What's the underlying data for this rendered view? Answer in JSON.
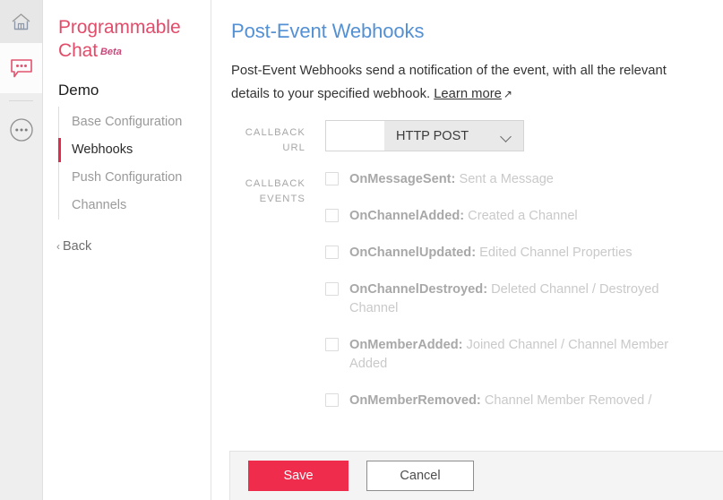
{
  "rail": {
    "items": [
      {
        "name": "home-icon",
        "label": "Home"
      },
      {
        "name": "chat-icon",
        "label": "Programmable Chat"
      },
      {
        "name": "more-icon",
        "label": "More"
      }
    ]
  },
  "sidebar": {
    "brand": "Programmable Chat",
    "brand_badge": "Beta",
    "section_title": "Demo",
    "items": [
      {
        "label": "Base Configuration",
        "active": false
      },
      {
        "label": "Webhooks",
        "active": true
      },
      {
        "label": "Push Configuration",
        "active": false
      },
      {
        "label": "Channels",
        "active": false
      }
    ],
    "back_label": "Back",
    "back_chevron": "‹"
  },
  "main": {
    "title": "Post-Event Webhooks",
    "description_line1": "Post-Event Webhooks send a notification of the event, with all the relevant",
    "description_line2_prefix": "details to your specified webhook. ",
    "learn_more_label": "Learn more",
    "learn_more_arrow": "↗",
    "callback_url": {
      "label": "Callback URL",
      "input_value": "",
      "input_placeholder": "",
      "method_selected": "HTTP POST"
    },
    "callback_events": {
      "label": "Callback Events",
      "items": [
        {
          "name": "OnMessageSent:",
          "description": " Sent a Message",
          "checked": false
        },
        {
          "name": "OnChannelAdded:",
          "description": " Created a Channel",
          "checked": false
        },
        {
          "name": "OnChannelUpdated:",
          "description": " Edited Channel Properties",
          "checked": false
        },
        {
          "name": "OnChannelDestroyed:",
          "description": " Deleted Channel / Destroyed Channel",
          "checked": false
        },
        {
          "name": "OnMemberAdded:",
          "description": " Joined Channel / Channel Member Added",
          "checked": false
        },
        {
          "name": "OnMemberRemoved:",
          "description": " Channel Member Removed /",
          "checked": false
        }
      ]
    }
  },
  "footer": {
    "save_label": "Save",
    "cancel_label": "Cancel"
  },
  "colors": {
    "brand_red": "#e34b6a",
    "accent_red": "#f02c4d",
    "title_blue": "#5390d4",
    "active_marker": "#e02b4c"
  }
}
